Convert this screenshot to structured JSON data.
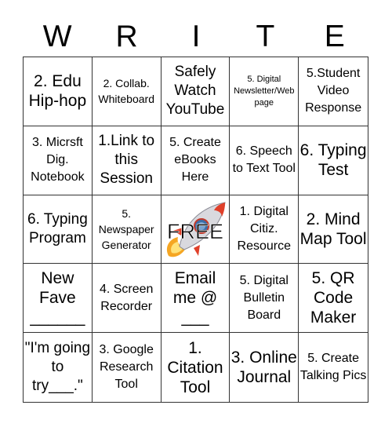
{
  "header": {
    "letters": [
      "W",
      "R",
      "I",
      "T",
      "E"
    ]
  },
  "board": {
    "free_label": "FREE",
    "cells": [
      {
        "text": "2. Edu Hip-hop",
        "size": "xl"
      },
      {
        "text": "2. Collab. Whiteboard",
        "size": "sm"
      },
      {
        "text": "Safely Watch YouTube",
        "size": "lg"
      },
      {
        "text": "5. Digital Newsletter/Web page",
        "size": "xs"
      },
      {
        "text": "5.Student Video Response",
        "size": "md"
      },
      {
        "text": "3. Micrsft Dig. Notebook",
        "size": "md"
      },
      {
        "text": "1.Link to this Session",
        "size": "lg"
      },
      {
        "text": "5. Create eBooks Here",
        "size": "md"
      },
      {
        "text": "6. Speech to Text Tool",
        "size": "md"
      },
      {
        "text": "6. Typing Test",
        "size": "xl"
      },
      {
        "text": "6. Typing Program",
        "size": "lg"
      },
      {
        "text": "5. Newspaper Generator",
        "size": "sm"
      },
      {
        "text": "FREE",
        "size": "free"
      },
      {
        "text": "1. Digital Citiz. Resource",
        "size": "md"
      },
      {
        "text": "2. Mind Map Tool",
        "size": "xl"
      },
      {
        "text": "New Fave ______",
        "size": "xl"
      },
      {
        "text": "4. Screen Recorder",
        "size": "md"
      },
      {
        "text": "Email me @ ___",
        "size": "xl"
      },
      {
        "text": "5. Digital Bulletin Board",
        "size": "md"
      },
      {
        "text": "5. QR Code Maker",
        "size": "xl"
      },
      {
        "text": "\"I'm going to try___.\"",
        "size": "lg"
      },
      {
        "text": "3. Google Research Tool",
        "size": "md"
      },
      {
        "text": "1. Citation Tool",
        "size": "xl"
      },
      {
        "text": "3. Online Journal",
        "size": "xl"
      },
      {
        "text": "5. Create Talking Pics",
        "size": "md"
      }
    ]
  },
  "colors": {
    "grid_line": "#333333",
    "text": "#000000",
    "background": "#ffffff",
    "rocket_body": "#d9d9de",
    "rocket_fin": "#e0402a",
    "rocket_flame": "#f5a623"
  }
}
